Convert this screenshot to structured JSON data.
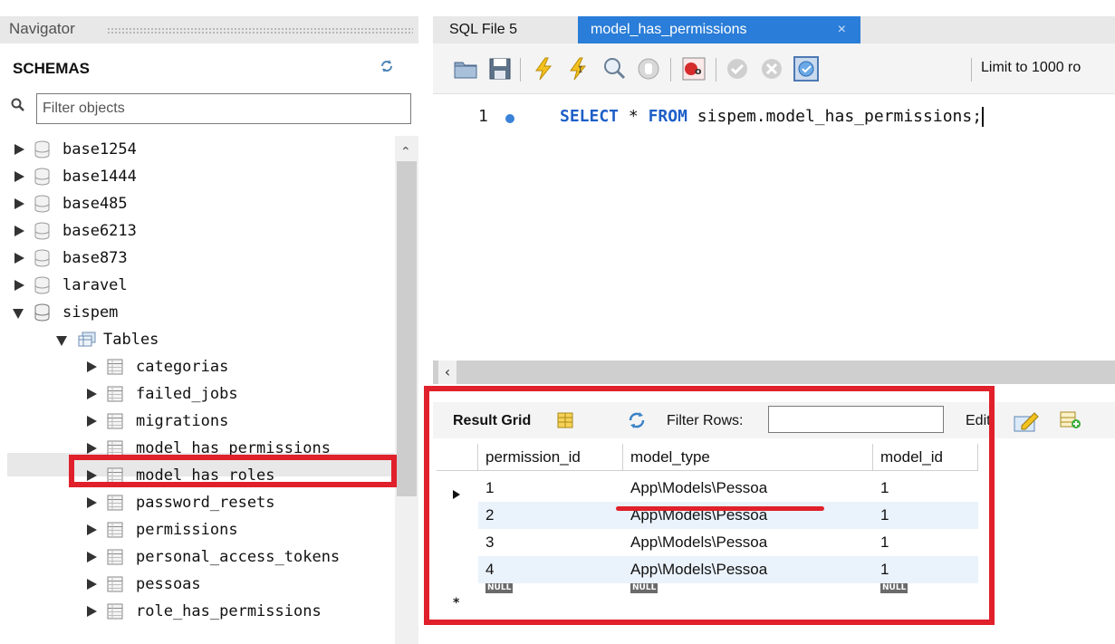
{
  "navigator": {
    "title": "Navigator",
    "section_label": "SCHEMAS",
    "filter_placeholder": "Filter objects",
    "schemas": [
      {
        "name": "base1254",
        "expanded": false
      },
      {
        "name": "base1444",
        "expanded": false
      },
      {
        "name": "base485",
        "expanded": false
      },
      {
        "name": "base6213",
        "expanded": false
      },
      {
        "name": "base873",
        "expanded": false
      },
      {
        "name": "laravel",
        "expanded": false
      },
      {
        "name": "sispem",
        "expanded": true
      }
    ],
    "tables_folder_label": "Tables",
    "tables": [
      "categorias",
      "failed_jobs",
      "migrations",
      "model_has_permissions",
      "model_has_roles",
      "password_resets",
      "permissions",
      "personal_access_tokens",
      "pessoas",
      "role_has_permissions"
    ],
    "selected_table": "model_has_permissions"
  },
  "tabs": [
    {
      "label": "SQL File 5",
      "active": false
    },
    {
      "label": "model_has_permissions",
      "active": true,
      "close": "×"
    }
  ],
  "toolbar": {
    "limit_label": "Limit to 1000 ro"
  },
  "editor": {
    "line_number": "1",
    "sql": {
      "kw_select": "SELECT",
      "star": "*",
      "kw_from": "FROM",
      "target": "sispem.model_has_permissions;"
    }
  },
  "result": {
    "grid_label": "Result Grid",
    "filter_label": "Filter Rows:",
    "edit_label": "Edit:",
    "columns": [
      "permission_id",
      "model_type",
      "model_id"
    ],
    "rows": [
      [
        "1",
        "App\\Models\\Pessoa",
        "1"
      ],
      [
        "2",
        "App\\Models\\Pessoa",
        "1"
      ],
      [
        "3",
        "App\\Models\\Pessoa",
        "1"
      ],
      [
        "4",
        "App\\Models\\Pessoa",
        "1"
      ]
    ],
    "null_label": "NULL"
  },
  "colors": {
    "accent_tab": "#2a7dd8",
    "keyword": "#1e5fc8",
    "highlight_red": "#e0202a",
    "alt_row": "#eaf2fb"
  }
}
